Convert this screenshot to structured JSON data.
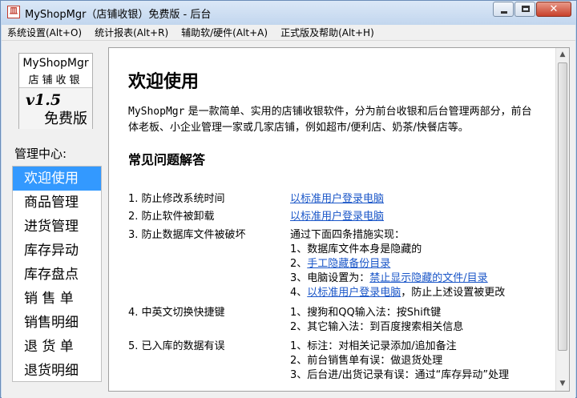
{
  "window": {
    "title": "MyShopMgr（店铺收银）免费版 - 后台",
    "app_icon_glyph": "皿"
  },
  "menubar": {
    "items": [
      {
        "label": "系统设置(Alt+O)"
      },
      {
        "label": "统计报表(Alt+R)"
      },
      {
        "label": "辅助软/硬件(Alt+A)"
      },
      {
        "label": "正式版及帮助(Alt+H)"
      }
    ]
  },
  "sidebar": {
    "logo_name": "MyShopMgr",
    "logo_sub": "店铺收银",
    "version": "v1.5",
    "edition": "免费版",
    "mgmt_label": "管理中心:",
    "items": [
      {
        "label": "欢迎使用",
        "active": true
      },
      {
        "label": "商品管理"
      },
      {
        "label": "进货管理"
      },
      {
        "label": "库存异动"
      },
      {
        "label": "库存盘点"
      },
      {
        "label": "销 售 单"
      },
      {
        "label": "销售明细"
      },
      {
        "label": "退 货 单"
      },
      {
        "label": "退货明细"
      }
    ]
  },
  "content": {
    "heading": "欢迎使用",
    "intro_brand": "MyShopMgr",
    "intro_line1": " 是一款简单、实用的店铺收银软件，分为前台收银和后台管理两部分，前台",
    "intro_line2": "体老板、小企业管理一家或几家店铺，例如超市/便利店、奶茶/快餐店等。",
    "faq_heading": "常见问题解答",
    "faq": {
      "q1": "1. 防止修改系统时间",
      "a1_link": "以标准用户登录电脑",
      "q2": "2. 防止软件被卸载",
      "a2_link": "以标准用户登录电脑",
      "q3": "3. 防止数据库文件被破坏",
      "a3_intro": "通过下面四条措施实现：",
      "a3_1": "1、数据库文件本身是隐藏的",
      "a3_2_prefix": "2、",
      "a3_2_link": "手工隐藏备份目录",
      "a3_3_prefix": "3、电脑设置为：",
      "a3_3_link": "禁止显示隐藏的文件/目录",
      "a3_4_prefix": "4、",
      "a3_4_link": "以标准用户登录电脑",
      "a3_4_suffix": "，防止上述设置被更改",
      "q4": "4. 中英文切换快捷键",
      "a4_1": "1、搜狗和QQ输入法：按Shift键",
      "a4_2": "2、其它输入法：到百度搜索相关信息",
      "q5": "5. 已入库的数据有误",
      "a5_1": "1、标注：对相关记录添加/追加备注",
      "a5_2": "2、前台销售单有误：做退货处理",
      "a5_3": "3、后台进/出货记录有误：通过“库存异动”处理"
    }
  }
}
